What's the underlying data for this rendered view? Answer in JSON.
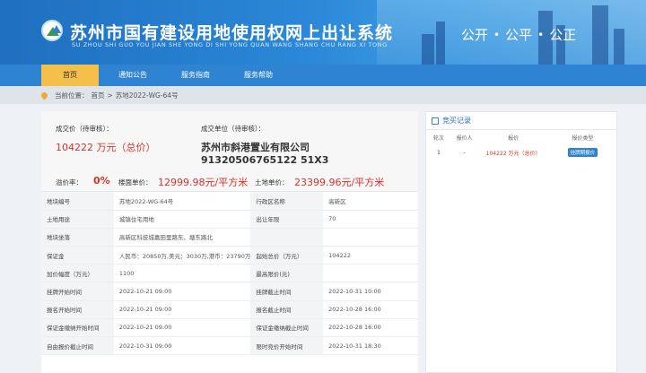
{
  "header": {
    "title": "苏州市国有建设用地使用权网上出让系统",
    "subtitle": "SU ZHOU SHI GUO YOU JIAN SHE YONG DI SHI YONG QUAN WANG SHANG CHU RANG XI TONG",
    "slogans": [
      "公开",
      "公平",
      "公正"
    ]
  },
  "nav": {
    "items": [
      "首页",
      "通知公告",
      "服务指南",
      "服务帮助"
    ]
  },
  "breadcrumb": {
    "prefix": "当前位置：",
    "home": "首页",
    "sep": ">",
    "current": "苏地2022-WG-64号"
  },
  "summary": {
    "deal_price_label": "成交价（待审核）：",
    "deal_price_value": "104222 万元（总价）",
    "winner_label": "成交单位（待审核）：",
    "winner_name": "苏州市斜港置业有限公司",
    "winner_code": "91320506765122 51X3",
    "premium_label": "溢价率：",
    "premium_value": "0%",
    "floor_price_label": "楼面单价：",
    "floor_price_value": "12999.98元/平方米",
    "land_price_label": "土地单价：",
    "land_price_value": "23399.96元/平方米"
  },
  "info_rows": [
    [
      "地块编号",
      "苏地2022-WG-64号",
      "行政区名称",
      "高新区"
    ],
    [
      "土地用途",
      "城镇住宅用地",
      "出让年限",
      "70"
    ],
    [
      "地块坐落",
      "高新区科技城嘉田里路东、塘东路北",
      "",
      ""
    ],
    [
      "保证金",
      "人民币：20850万,美元：3030万,港币：23790万",
      "起始总价（万元）",
      "104222"
    ],
    [
      "加价幅度（万元）",
      "1100",
      "最高限价(元)",
      ""
    ],
    [
      "挂牌开始时间",
      "2022-10-21 09:00",
      "挂牌截止时间",
      "2022-10-31 10:00"
    ],
    [
      "报名开始时间",
      "2022-10-21 09:00",
      "报名截止时间",
      "2022-10-28 16:00"
    ],
    [
      "保证金缴纳开始时间",
      "2022-10-21 09:00",
      "保证金缴纳截止时间",
      "2022-10-28 16:00"
    ],
    [
      "自由报价截止时间",
      "2022-10-31 09:00",
      "限时竞价开始时间",
      "2022-10-31 18:30"
    ]
  ],
  "bids": {
    "title": "竞买记录",
    "columns": [
      "轮次",
      "报价人",
      "报价",
      "报价类型"
    ],
    "rows": [
      {
        "round": "1",
        "bidder": "-",
        "price": "104222 万元（总价）",
        "type": "挂牌期报价"
      }
    ]
  }
}
